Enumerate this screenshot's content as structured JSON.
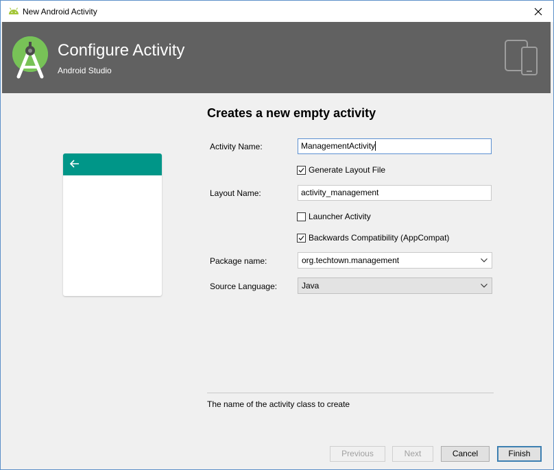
{
  "window": {
    "title": "New Android Activity"
  },
  "banner": {
    "title": "Configure Activity",
    "subtitle": "Android Studio"
  },
  "form": {
    "heading": "Creates a new empty activity",
    "activity_name_label": "Activity Name:",
    "activity_name_value": "ManagementActivity",
    "generate_layout_label": "Generate Layout File",
    "generate_layout_checked": true,
    "layout_name_label": "Layout Name:",
    "layout_name_value": "activity_management",
    "launcher_label": "Launcher Activity",
    "launcher_checked": false,
    "backwards_label": "Backwards Compatibility (AppCompat)",
    "backwards_checked": true,
    "package_label": "Package name:",
    "package_value": "org.techtown.management",
    "source_label": "Source Language:",
    "source_value": "Java"
  },
  "hint": "The name of the activity class to create",
  "buttons": {
    "previous": "Previous",
    "next": "Next",
    "cancel": "Cancel",
    "finish": "Finish"
  },
  "colors": {
    "banner": "#616161",
    "preview_bar": "#009688",
    "android_green": "#a4c639"
  },
  "icons": {
    "title": "android-icon",
    "logo": "android-studio-logo-icon",
    "devices": "devices-icon",
    "back": "arrow-left-icon",
    "close": "close-icon",
    "dropdown": "chevron-down-icon"
  }
}
